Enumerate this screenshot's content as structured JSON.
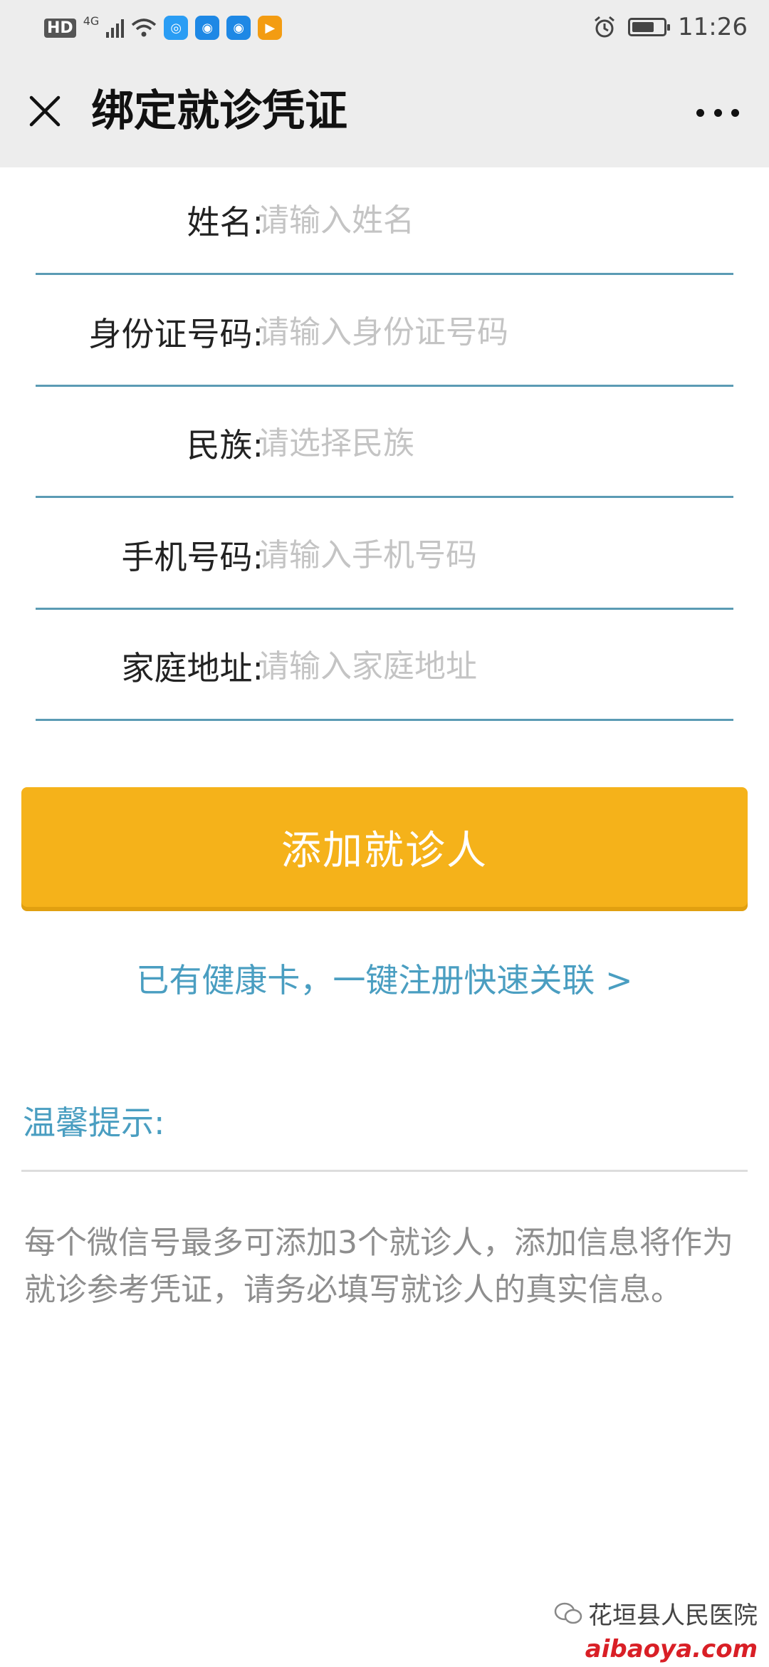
{
  "status_bar": {
    "hd": "HD",
    "network": "4G",
    "time": "11:26",
    "apps": [
      {
        "icon": "browser-app-icon",
        "glyph": "◎",
        "color": "#2a9df4"
      },
      {
        "icon": "wifi-app-icon",
        "glyph": "◉",
        "color": "#1e88e5"
      },
      {
        "icon": "wifi-app-icon",
        "glyph": "◉",
        "color": "#1e88e5"
      },
      {
        "icon": "video-app-icon",
        "glyph": "▶",
        "color": "#f39c12"
      }
    ]
  },
  "header": {
    "title": "绑定就诊凭证",
    "close_icon": "close-icon",
    "more_icon": "more-icon"
  },
  "form": {
    "fields": [
      {
        "label": "姓名:",
        "placeholder": "请输入姓名",
        "value": ""
      },
      {
        "label": "身份证号码:",
        "placeholder": "请输入身份证号码",
        "value": ""
      },
      {
        "label": "民族:",
        "placeholder": "请选择民族",
        "value": ""
      },
      {
        "label": "手机号码:",
        "placeholder": "请输入手机号码",
        "value": ""
      },
      {
        "label": "家庭地址:",
        "placeholder": "请输入家庭地址",
        "value": ""
      }
    ]
  },
  "add_button": "添加就诊人",
  "health_card_link": "已有健康卡，一键注册快速关联 >",
  "tips": {
    "title": "温馨提示:",
    "body": "每个微信号最多可添加3个就诊人，添加信息将作为就诊参考凭证，请务必填写就诊人的真实信息。"
  },
  "watermark": {
    "source": "花垣县人民医院",
    "site": "aibaoya.com"
  },
  "colors": {
    "accent": "#4a9ec1",
    "button": "#f5b21a",
    "divider": "#5b9bb4"
  }
}
